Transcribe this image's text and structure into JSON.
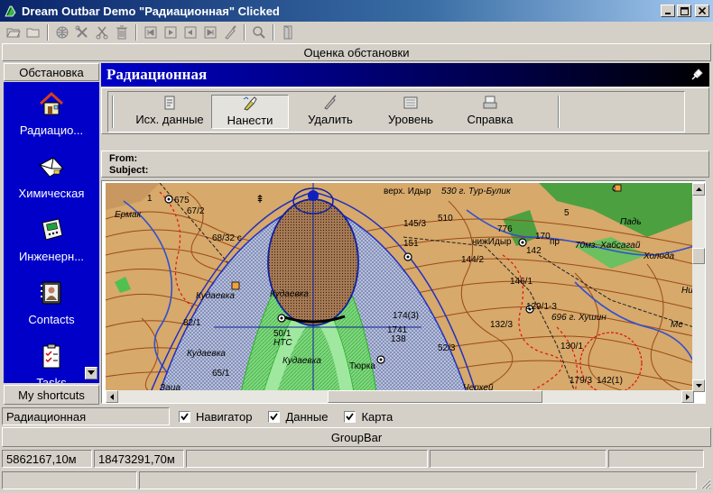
{
  "window": {
    "title": "Dream Outbar Demo \"Радиационная\" Clicked"
  },
  "header": {
    "title": "Оценка обстановки"
  },
  "sidebar": {
    "title": "Обстановка",
    "items": [
      {
        "label": "Радиацио...",
        "icon": "house-radiation-icon"
      },
      {
        "label": "Химическая",
        "icon": "envelope-chemical-icon"
      },
      {
        "label": "Инженерн...",
        "icon": "device-engineering-icon"
      },
      {
        "label": "Contacts",
        "icon": "contacts-icon"
      },
      {
        "label": "Tasks",
        "icon": "clipboard-tasks-icon"
      }
    ],
    "footer": "My shortcuts"
  },
  "panel": {
    "title": "Радиационная",
    "commands": [
      {
        "label": "Исх. данные",
        "icon": "source-data-icon"
      },
      {
        "label": "Нанести",
        "icon": "apply-icon",
        "active": true
      },
      {
        "label": "Удалить",
        "icon": "delete-pen-icon"
      },
      {
        "label": "Уровень",
        "icon": "level-icon"
      },
      {
        "label": "Справка",
        "icon": "help-icon"
      }
    ],
    "mail": {
      "from_label": "From:",
      "subject_label": "Subject:"
    }
  },
  "map_labels": {
    "l1": "1",
    "l2": "675",
    "l3": "67/2",
    "l4": "Ермак",
    "l5": "верх. Идыр",
    "l6": "530 г. Тур-Булик",
    "l7": "145/3",
    "l8": "510",
    "l9": "68/32 с",
    "l10": "151",
    "l11": "Падь",
    "l12": "776",
    "l13": "пр",
    "l14": "нижИдыр",
    "l15": "170",
    "l16": "70мз. Хабсагай",
    "l17": "Холода",
    "l18": "144/2",
    "l19": "142",
    "l20": "146/1",
    "l21": "Кудаевка",
    "l22": "129/1-3",
    "l23": "696 г. Хушин",
    "l24": "132/3",
    "l25": "82/1",
    "l26": "50/1",
    "l27": "138",
    "l28": "130/1",
    "l29": "Кудаевка",
    "l30": "52/3",
    "l31": "Кудаевка",
    "l32": "Тюрка",
    "l33": "142(1)",
    "l34": "179/3",
    "l35": "Черхей",
    "l36": "Ме",
    "l37": "Ник",
    "l38": "5",
    "l39": "65/1",
    "l40": "Заца",
    "l41": "Кудаевка",
    "l42": "1741",
    "l43": "174(3)",
    "l44": "НТС"
  },
  "checkrow": {
    "label": "Радиационная",
    "checks": [
      {
        "label": "Навигатор",
        "checked": true
      },
      {
        "label": "Данные",
        "checked": true
      },
      {
        "label": "Карта",
        "checked": true
      }
    ]
  },
  "groupbar": {
    "label": "GroupBar"
  },
  "status": {
    "coord_x": "5862167,10м",
    "coord_y": "18473291,70м"
  },
  "colors": {
    "title_start": "#0a246a",
    "sidebar_bg": "#0000c8",
    "panel_title_start": "#0000c8",
    "map_base": "#d7a96a",
    "contour": "#9a4a1a",
    "zone_fill": "#7cd87c",
    "ellipse_fill": "#a57a55",
    "zone_outline": "#2030c0"
  }
}
